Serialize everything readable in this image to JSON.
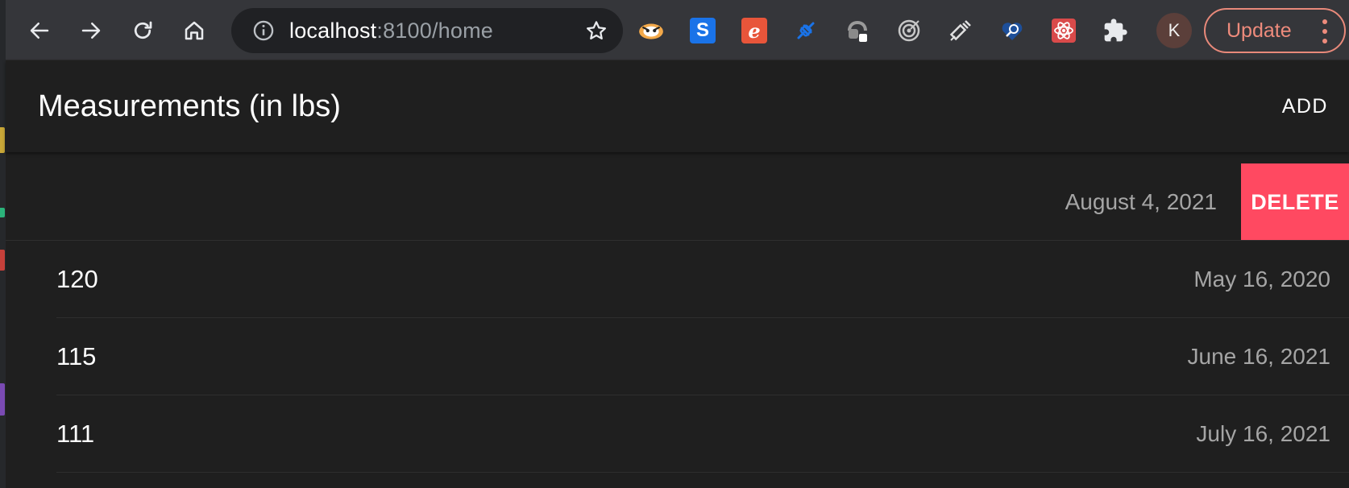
{
  "browser": {
    "url_host": "localhost",
    "url_path": ":8100/home",
    "avatar_letter": "K",
    "update_label": "Update",
    "extensions": [
      {
        "name": "badger-icon",
        "color": "#f0a33a"
      },
      {
        "name": "s-extension-icon",
        "letter": "S",
        "color": "#1a73e8"
      },
      {
        "name": "e-extension-icon",
        "letter": "e",
        "color": "#e8553a"
      },
      {
        "name": "plug-icon",
        "color": "#1a73e8"
      },
      {
        "name": "grey-extension-icon",
        "color": "#8a8a8a"
      },
      {
        "name": "target-icon",
        "color": "#c7c7c7"
      },
      {
        "name": "syringe-icon",
        "color": "#e0e0e0"
      },
      {
        "name": "heart-search-icon",
        "color": "#1a73e8"
      },
      {
        "name": "atom-extension-icon",
        "color": "#e05a5a"
      },
      {
        "name": "puzzle-icon",
        "color": "#e8e8e8"
      }
    ]
  },
  "header": {
    "title": "Measurements (in lbs)",
    "add_label": "ADD"
  },
  "measurements": [
    {
      "weight": "",
      "date": "August 4, 2021",
      "delete_label": "DELETE"
    },
    {
      "weight": "120",
      "date": "May 16, 2020"
    },
    {
      "weight": "115",
      "date": "June 16, 2021"
    },
    {
      "weight": "111",
      "date": "July 16, 2021"
    }
  ],
  "colors": {
    "delete": "#ff4961",
    "update": "#ee8b7c",
    "background": "#1f1f1f",
    "toolbar": "#35363a"
  }
}
